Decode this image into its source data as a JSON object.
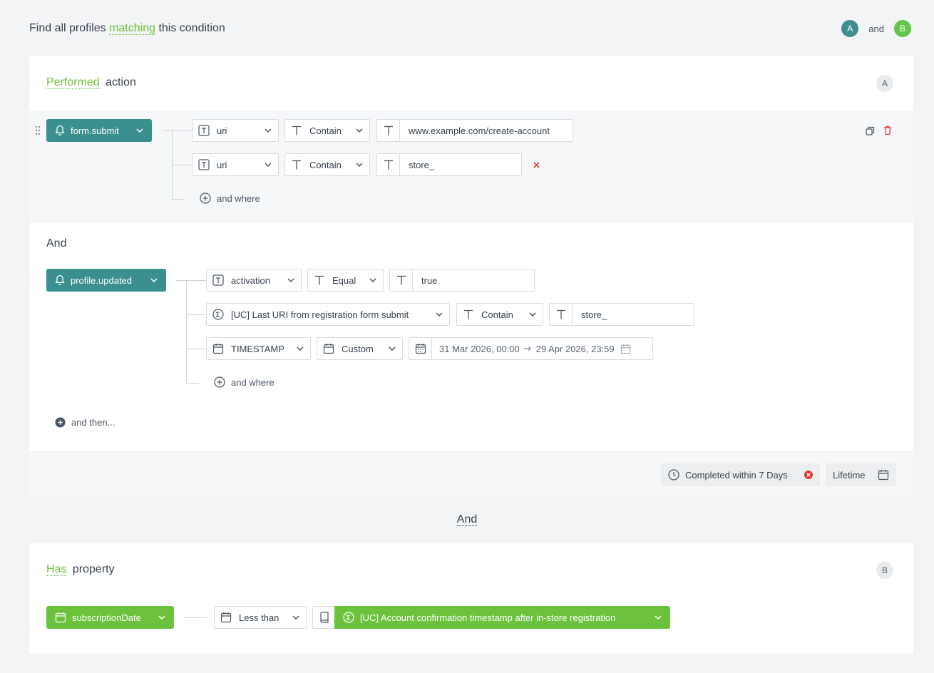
{
  "header": {
    "prefix": "Find all profiles",
    "highlight": "matching",
    "suffix": "this condition",
    "badge_a": "A",
    "joiner": "and",
    "badge_b": "B"
  },
  "block_a": {
    "title_highlight": "Performed",
    "title_rest": "action",
    "letter": "A",
    "step1": {
      "event": "form.submit",
      "filters": [
        {
          "param": "uri",
          "operator": "Contain",
          "value": "www.example.com/create-account"
        },
        {
          "param": "uri",
          "operator": "Contain",
          "value": "store_"
        }
      ],
      "add_where": "and where"
    },
    "joiner": "And",
    "step2": {
      "event": "profile.updated",
      "filters": [
        {
          "param": "activation",
          "operator": "Equal",
          "value": "true"
        },
        {
          "param": "[UC] Last URI from registration form submit",
          "operator": "Contain",
          "value": "store_"
        },
        {
          "param": "TIMESTAMP",
          "operator": "Custom",
          "from": "31 Mar 2026, 00:00",
          "to": "29 Apr 2026, 23:59"
        }
      ],
      "add_where": "and where"
    },
    "and_then": "and then...",
    "completed": "Completed within 7 Days",
    "lifetime": "Lifetime"
  },
  "middle_joiner": "And",
  "block_b": {
    "title_highlight": "Has",
    "title_rest": "property",
    "letter": "B",
    "property": "subscriptionDate",
    "operator": "Less than",
    "value": "[UC] Account confirmation timestamp after in-store registration"
  },
  "colors": {
    "teal": "#3b8f8f",
    "green": "#6cc23d",
    "delete_red": "#e03a3a"
  }
}
